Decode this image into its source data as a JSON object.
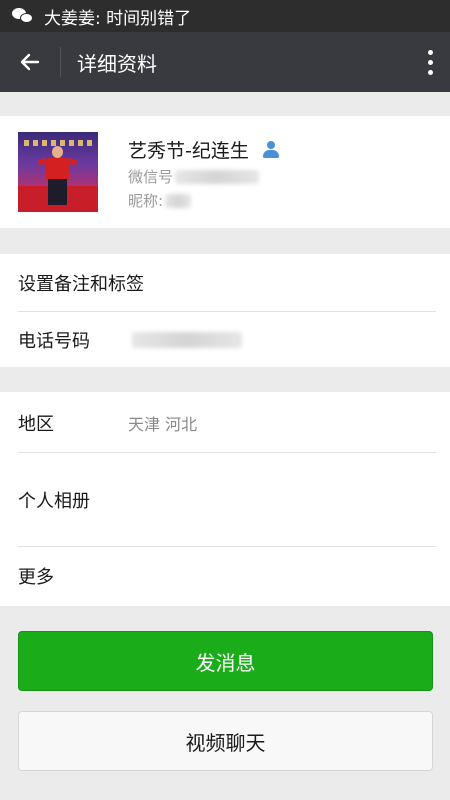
{
  "status_bar": {
    "notification_icon": "wechat-icon",
    "notification_text": "大姜姜: 时间别错了"
  },
  "app_bar": {
    "back_icon": "arrow-left-icon",
    "title": "详细资料",
    "more_icon": "more-vertical-icon"
  },
  "profile": {
    "name": "艺秀节-纪连生",
    "badge_icon": "person-icon",
    "wechat_id_label": "微信号",
    "nickname_label": "昵称: "
  },
  "section_remark": {
    "remark_label": "设置备注和标签",
    "phone_label": "电话号码"
  },
  "section_info": {
    "region_label": "地区",
    "region_value": "天津  河北",
    "album_label": "个人相册",
    "more_label": "更多"
  },
  "actions": {
    "message_label": "发消息",
    "video_label": "视频聊天"
  },
  "colors": {
    "primary": "#1aad19",
    "appbar": "#393a3f",
    "statusbar": "#2d2d2d",
    "badge": "#4a90d9"
  }
}
